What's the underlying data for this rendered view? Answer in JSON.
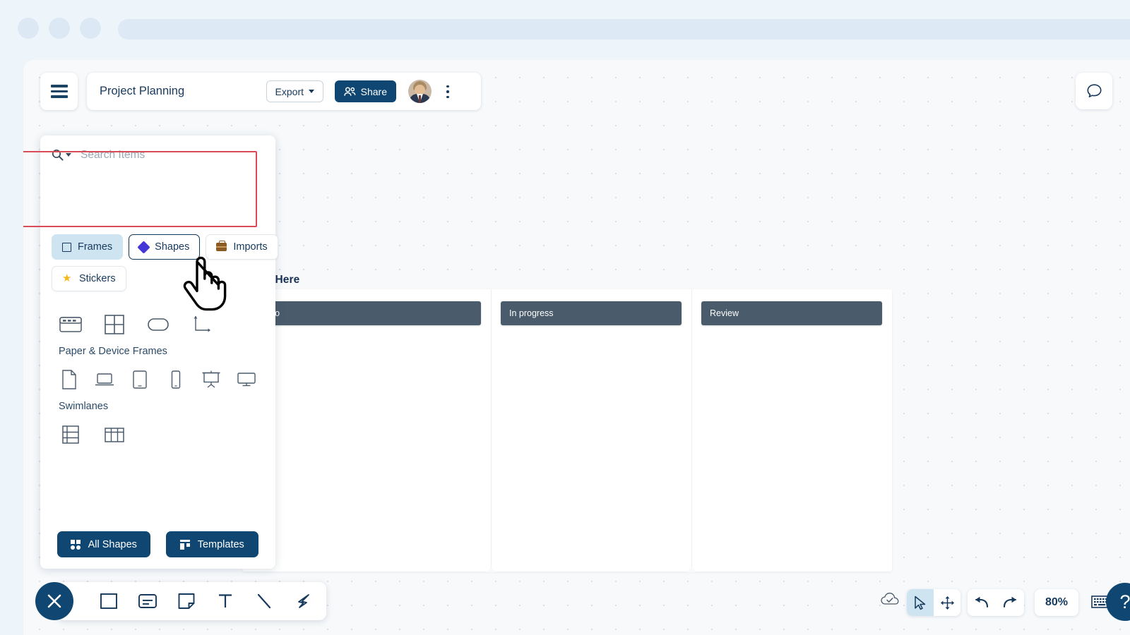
{
  "header": {
    "menu_icon": "hamburger-icon",
    "doc_title": "Project Planning",
    "export_label": "Export",
    "share_label": "Share",
    "kebab_icon": "more-vertical-icon",
    "chat_icon": "chat-bubble-icon"
  },
  "panel": {
    "search_placeholder": "Search Items",
    "search_value": "",
    "search_icon": "magnifier-icon",
    "tabs": [
      {
        "label": "Frames",
        "icon": "square-outline-icon",
        "state": "active"
      },
      {
        "label": "Shapes",
        "icon": "diamond-icon",
        "state": "selected"
      },
      {
        "label": "Imports",
        "icon": "briefcase-icon",
        "state": "normal"
      },
      {
        "label": "Stickers",
        "icon": "star-icon",
        "state": "normal"
      }
    ],
    "sections": [
      {
        "label": "",
        "items": [
          "browser-frame-icon",
          "grid-frame-icon",
          "rounded-rect-frame-icon",
          "axis-frame-icon"
        ]
      },
      {
        "label": "Paper & Device Frames",
        "items": [
          "document-page-icon",
          "laptop-icon",
          "tablet-landscape-icon",
          "phone-icon",
          "presentation-board-icon",
          "desktop-monitor-icon"
        ]
      },
      {
        "label": "Swimlanes",
        "items": [
          "swimlane-horizontal-icon",
          "swimlane-vertical-icon"
        ]
      }
    ],
    "actions": {
      "all_shapes_label": "All Shapes",
      "all_shapes_icon": "grid-dots-icon",
      "templates_label": "Templates",
      "templates_icon": "template-layout-icon"
    },
    "highlight_color": "#d94b55"
  },
  "canvas": {
    "board_title": "Title Here",
    "columns": [
      {
        "label": "Todo"
      },
      {
        "label": "In progress"
      },
      {
        "label": "Review"
      }
    ],
    "column_color": "#4a5b6b"
  },
  "bottom_toolbar": {
    "close_icon": "close-x-icon",
    "tools": [
      {
        "icon": "rectangle-shape-icon"
      },
      {
        "icon": "card-shape-icon"
      },
      {
        "icon": "sticky-note-icon"
      },
      {
        "icon": "text-tool-icon"
      },
      {
        "icon": "line-tool-icon"
      },
      {
        "icon": "pen-tool-icon"
      }
    ]
  },
  "bottom_right": {
    "cloud_icon": "cloud-saved-icon",
    "select_icon": "cursor-arrow-icon",
    "pan_icon": "move-arrows-icon",
    "undo_icon": "undo-arrow-icon",
    "redo_icon": "redo-arrow-icon",
    "zoom_level": "80%",
    "keyboard_icon": "keyboard-icon",
    "help_label": "?"
  },
  "theme": {
    "brand_dark": "#0f4772",
    "accent_blue": "#cfe4f1",
    "text_dark": "#17395c"
  }
}
